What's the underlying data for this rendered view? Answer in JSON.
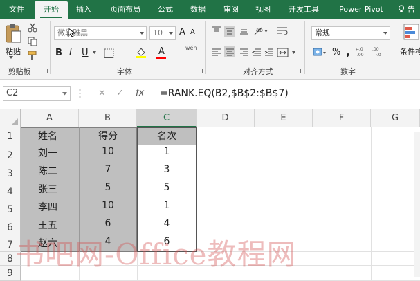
{
  "ribbon_tabs": [
    "文件",
    "开始",
    "插入",
    "页面布局",
    "公式",
    "数据",
    "审阅",
    "视图",
    "开发工具",
    "Power Pivot",
    "告"
  ],
  "active_tab": "开始",
  "ribbon": {
    "clipboard": {
      "paste_label": "粘贴",
      "group_label": "剪贴板"
    },
    "font": {
      "font_name": "微软雅黑",
      "font_size": "10",
      "group_label": "字体",
      "bold": "B",
      "italic": "I",
      "underline": "U",
      "grow": "A",
      "shrink": "A",
      "font_color_glyph": "A",
      "wen": "wén",
      "fill_color": "#ffff00",
      "text_color": "#ff0000"
    },
    "alignment": {
      "group_label": "对齐方式"
    },
    "number": {
      "format": "常规",
      "group_label": "数字",
      "percent": "%",
      "comma": ","
    },
    "styles": {
      "conditional_format_label": "条件格"
    }
  },
  "formula_bar": {
    "name_box": "C2",
    "cancel": "×",
    "enter": "✓",
    "fx": "fx",
    "formula": "=RANK.EQ(B2,$B$2:$B$7)"
  },
  "sheet": {
    "columns": [
      "A",
      "B",
      "C",
      "D",
      "E",
      "F",
      "G"
    ],
    "selected_column": "C",
    "rows": [
      "1",
      "2",
      "3",
      "4",
      "5",
      "6",
      "7",
      "8",
      "9"
    ],
    "headers": {
      "name": "姓名",
      "score": "得分",
      "rank": "名次"
    },
    "data": [
      {
        "name": "刘一",
        "score": "10",
        "rank": "1"
      },
      {
        "name": "陈二",
        "score": "7",
        "rank": "3"
      },
      {
        "name": "张三",
        "score": "5",
        "rank": "5"
      },
      {
        "name": "李四",
        "score": "10",
        "rank": "1"
      },
      {
        "name": "王五",
        "score": "6",
        "rank": "4"
      },
      {
        "name": "赵六",
        "score": "4",
        "rank": "6"
      }
    ]
  },
  "watermark": "书吧网-Office教程网",
  "colors": {
    "accent": "#217346",
    "gray_fill": "#bfbfbf"
  }
}
